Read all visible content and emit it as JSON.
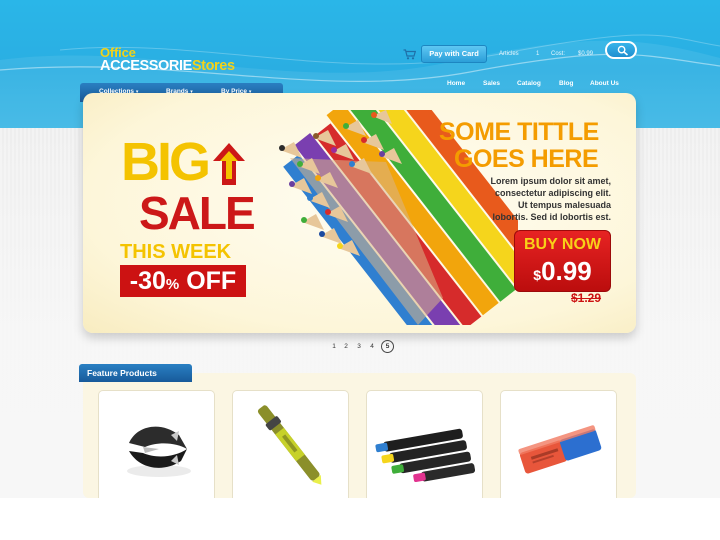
{
  "logo": {
    "line1": "Office",
    "brand_main": "ACCESSORIE",
    "brand_suffix": "Stores"
  },
  "topbar": {
    "pay_button": "Pay with Card",
    "articles_label": "Articles",
    "articles_count": "1",
    "cost_label": "Cost:",
    "cost_value": "$0.99",
    "icons": [
      "cart-icon",
      "search-icon"
    ]
  },
  "category_menu": [
    {
      "label": "Collections"
    },
    {
      "label": "Brands"
    },
    {
      "label": "By Price"
    }
  ],
  "nav": [
    {
      "label": "Home"
    },
    {
      "label": "Sales"
    },
    {
      "label": "Catalog"
    },
    {
      "label": "Blog"
    },
    {
      "label": "About Us"
    }
  ],
  "banner": {
    "big": "BIG",
    "sale": "SALE",
    "week": "THIS WEEK",
    "discount": "-30",
    "discount_unit": "%",
    "discount_suffix": " OFF",
    "title_line1": "SOME TITTLE",
    "title_line2": "GOES HERE",
    "body_lines": [
      "Lorem ipsum dolor sit amet,",
      "consectetur adipiscing elit.",
      "Ut tempus malesuada",
      "lobortis. Sed id lobortis est."
    ],
    "buy_now": "BUY NOW",
    "currency": "$",
    "price": "0.99",
    "old_price": "$1.29"
  },
  "pagination": {
    "pages": [
      "1",
      "2",
      "3",
      "4",
      "5"
    ],
    "active": "5"
  },
  "featured": {
    "title": "Feature Products",
    "products": [
      {
        "icon": "staple-remover-icon"
      },
      {
        "icon": "highlighter-pen-icon"
      },
      {
        "icon": "markers-icon"
      },
      {
        "icon": "eraser-icon"
      }
    ]
  },
  "colors": {
    "header_blue": "#2ab6e8",
    "nav_dark_blue": "#1b5f9f",
    "sale_red": "#cc1818",
    "promo_orange": "#f49c00",
    "big_yellow": "#f4c300",
    "banner_cream": "#fdf6d9"
  }
}
